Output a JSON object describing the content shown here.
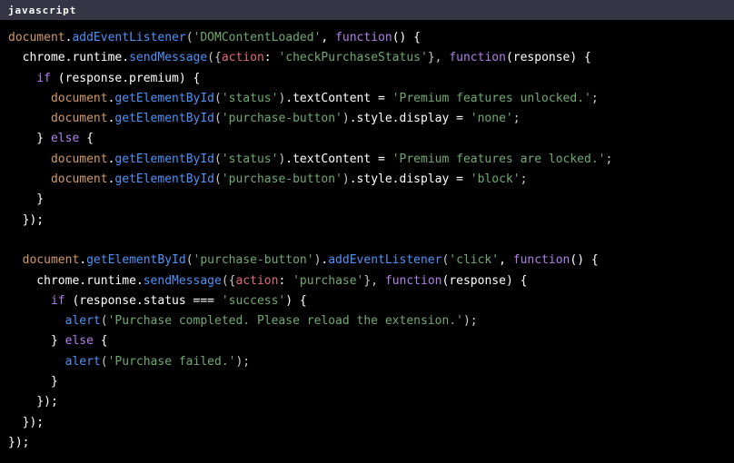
{
  "header": {
    "language_label": "javascript",
    "bar_color": "#353545",
    "text_color": "#ffffff"
  },
  "theme": {
    "background": "#000000",
    "default_text": "#ffffff",
    "variable": "#d19a66",
    "function": "#4f92f7",
    "keyword": "#b07fe8",
    "string": "#70a970",
    "property_key": "#e06c75",
    "punctuation": "#c8c8c8"
  },
  "code": {
    "language": "javascript",
    "lines": [
      [
        {
          "t": "document",
          "c": "var"
        },
        {
          "t": ".",
          "c": "plain"
        },
        {
          "t": "addEventListener",
          "c": "fn"
        },
        {
          "t": "(",
          "c": "punct"
        },
        {
          "t": "'DOMContentLoaded'",
          "c": "str"
        },
        {
          "t": ", ",
          "c": "plain"
        },
        {
          "t": "function",
          "c": "kw"
        },
        {
          "t": "() {",
          "c": "plain"
        }
      ],
      [
        {
          "t": "  chrome",
          "c": "plain"
        },
        {
          "t": ".",
          "c": "plain"
        },
        {
          "t": "runtime",
          "c": "plain"
        },
        {
          "t": ".",
          "c": "plain"
        },
        {
          "t": "sendMessage",
          "c": "fn"
        },
        {
          "t": "({",
          "c": "punct"
        },
        {
          "t": "action",
          "c": "key"
        },
        {
          "t": ": ",
          "c": "plain"
        },
        {
          "t": "'checkPurchaseStatus'",
          "c": "str"
        },
        {
          "t": "}, ",
          "c": "punct"
        },
        {
          "t": "function",
          "c": "kw"
        },
        {
          "t": "(response) {",
          "c": "plain"
        }
      ],
      [
        {
          "t": "    ",
          "c": "plain"
        },
        {
          "t": "if",
          "c": "kw"
        },
        {
          "t": " (response.premium) {",
          "c": "plain"
        }
      ],
      [
        {
          "t": "      ",
          "c": "plain"
        },
        {
          "t": "document",
          "c": "var"
        },
        {
          "t": ".",
          "c": "plain"
        },
        {
          "t": "getElementById",
          "c": "fn"
        },
        {
          "t": "(",
          "c": "punct"
        },
        {
          "t": "'status'",
          "c": "str"
        },
        {
          "t": ")",
          "c": "punct"
        },
        {
          "t": ".textContent = ",
          "c": "plain"
        },
        {
          "t": "'Premium features unlocked.'",
          "c": "str"
        },
        {
          "t": ";",
          "c": "punct"
        }
      ],
      [
        {
          "t": "      ",
          "c": "plain"
        },
        {
          "t": "document",
          "c": "var"
        },
        {
          "t": ".",
          "c": "plain"
        },
        {
          "t": "getElementById",
          "c": "fn"
        },
        {
          "t": "(",
          "c": "punct"
        },
        {
          "t": "'purchase-button'",
          "c": "str"
        },
        {
          "t": ")",
          "c": "punct"
        },
        {
          "t": ".style.display = ",
          "c": "plain"
        },
        {
          "t": "'none'",
          "c": "str"
        },
        {
          "t": ";",
          "c": "punct"
        }
      ],
      [
        {
          "t": "    } ",
          "c": "plain"
        },
        {
          "t": "else",
          "c": "kw"
        },
        {
          "t": " {",
          "c": "plain"
        }
      ],
      [
        {
          "t": "      ",
          "c": "plain"
        },
        {
          "t": "document",
          "c": "var"
        },
        {
          "t": ".",
          "c": "plain"
        },
        {
          "t": "getElementById",
          "c": "fn"
        },
        {
          "t": "(",
          "c": "punct"
        },
        {
          "t": "'status'",
          "c": "str"
        },
        {
          "t": ")",
          "c": "punct"
        },
        {
          "t": ".textContent = ",
          "c": "plain"
        },
        {
          "t": "'Premium features are locked.'",
          "c": "str"
        },
        {
          "t": ";",
          "c": "punct"
        }
      ],
      [
        {
          "t": "      ",
          "c": "plain"
        },
        {
          "t": "document",
          "c": "var"
        },
        {
          "t": ".",
          "c": "plain"
        },
        {
          "t": "getElementById",
          "c": "fn"
        },
        {
          "t": "(",
          "c": "punct"
        },
        {
          "t": "'purchase-button'",
          "c": "str"
        },
        {
          "t": ")",
          "c": "punct"
        },
        {
          "t": ".style.display = ",
          "c": "plain"
        },
        {
          "t": "'block'",
          "c": "str"
        },
        {
          "t": ";",
          "c": "punct"
        }
      ],
      [
        {
          "t": "    }",
          "c": "plain"
        }
      ],
      [
        {
          "t": "  });",
          "c": "plain"
        }
      ],
      [
        {
          "t": "",
          "c": "plain"
        }
      ],
      [
        {
          "t": "  ",
          "c": "plain"
        },
        {
          "t": "document",
          "c": "var"
        },
        {
          "t": ".",
          "c": "plain"
        },
        {
          "t": "getElementById",
          "c": "fn"
        },
        {
          "t": "(",
          "c": "punct"
        },
        {
          "t": "'purchase-button'",
          "c": "str"
        },
        {
          "t": ")",
          "c": "punct"
        },
        {
          "t": ".",
          "c": "plain"
        },
        {
          "t": "addEventListener",
          "c": "fn"
        },
        {
          "t": "(",
          "c": "punct"
        },
        {
          "t": "'click'",
          "c": "str"
        },
        {
          "t": ", ",
          "c": "plain"
        },
        {
          "t": "function",
          "c": "kw"
        },
        {
          "t": "() {",
          "c": "plain"
        }
      ],
      [
        {
          "t": "    chrome",
          "c": "plain"
        },
        {
          "t": ".",
          "c": "plain"
        },
        {
          "t": "runtime",
          "c": "plain"
        },
        {
          "t": ".",
          "c": "plain"
        },
        {
          "t": "sendMessage",
          "c": "fn"
        },
        {
          "t": "({",
          "c": "punct"
        },
        {
          "t": "action",
          "c": "key"
        },
        {
          "t": ": ",
          "c": "plain"
        },
        {
          "t": "'purchase'",
          "c": "str"
        },
        {
          "t": "}, ",
          "c": "punct"
        },
        {
          "t": "function",
          "c": "kw"
        },
        {
          "t": "(response) {",
          "c": "plain"
        }
      ],
      [
        {
          "t": "      ",
          "c": "plain"
        },
        {
          "t": "if",
          "c": "kw"
        },
        {
          "t": " (response.status === ",
          "c": "plain"
        },
        {
          "t": "'success'",
          "c": "str"
        },
        {
          "t": ") {",
          "c": "plain"
        }
      ],
      [
        {
          "t": "        ",
          "c": "plain"
        },
        {
          "t": "alert",
          "c": "fn"
        },
        {
          "t": "(",
          "c": "punct"
        },
        {
          "t": "'Purchase completed. Please reload the extension.'",
          "c": "str"
        },
        {
          "t": ");",
          "c": "punct"
        }
      ],
      [
        {
          "t": "      } ",
          "c": "plain"
        },
        {
          "t": "else",
          "c": "kw"
        },
        {
          "t": " {",
          "c": "plain"
        }
      ],
      [
        {
          "t": "        ",
          "c": "plain"
        },
        {
          "t": "alert",
          "c": "fn"
        },
        {
          "t": "(",
          "c": "punct"
        },
        {
          "t": "'Purchase failed.'",
          "c": "str"
        },
        {
          "t": ");",
          "c": "punct"
        }
      ],
      [
        {
          "t": "      }",
          "c": "plain"
        }
      ],
      [
        {
          "t": "    });",
          "c": "plain"
        }
      ],
      [
        {
          "t": "  });",
          "c": "plain"
        }
      ],
      [
        {
          "t": "});",
          "c": "plain"
        }
      ]
    ]
  }
}
